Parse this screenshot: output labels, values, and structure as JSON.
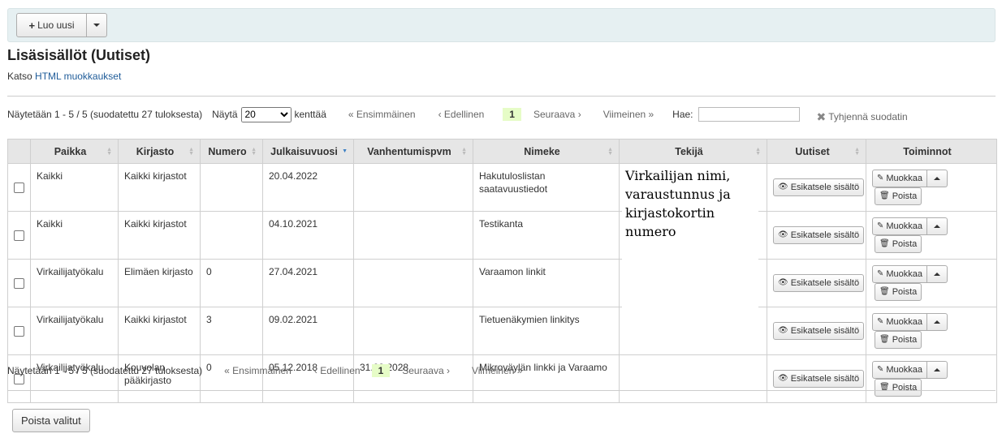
{
  "toolbar": {
    "new_label": "Luo uusi"
  },
  "page": {
    "title": "Lisäsisällöt (Uutiset)",
    "katso_prefix": "Katso",
    "katso_link": "HTML muokkaukset"
  },
  "top_pager": {
    "info": "Näytetään 1 - 5 / 5 (suodatettu 27 tuloksesta)",
    "show_label": "Näytä",
    "show_value": "20",
    "show_suffix": "kenttää",
    "first": "« Ensimmäinen",
    "prev": "‹ Edellinen",
    "current": "1",
    "next": "Seuraava ›",
    "last": "Viimeinen »",
    "search_label": "Hae:",
    "search_value": "",
    "clear": "Tyhjennä suodatin"
  },
  "columns": [
    "Paikka",
    "Kirjasto",
    "Numero",
    "Julkaisuvuosi",
    "Vanhentumispvm",
    "Nimeke",
    "Tekijä",
    "Uutiset",
    "Toiminnot"
  ],
  "rows": [
    {
      "paikka": "Kaikki",
      "kirjasto": "Kaikki kirjastot",
      "numero": "",
      "julkaisu": "20.04.2022",
      "vanhentuminen": "",
      "nimeke": "Hakutuloslistan saatavuustiedot"
    },
    {
      "paikka": "Kaikki",
      "kirjasto": "Kaikki kirjastot",
      "numero": "",
      "julkaisu": "04.10.2021",
      "vanhentuminen": "",
      "nimeke": "Testikanta"
    },
    {
      "paikka": "Virkailijatyökalu",
      "kirjasto": "Elimäen kirjasto",
      "numero": "0",
      "julkaisu": "27.04.2021",
      "vanhentuminen": "",
      "nimeke": "Varaamon linkit"
    },
    {
      "paikka": "Virkailijatyökalu",
      "kirjasto": "Kaikki kirjastot",
      "numero": "3",
      "julkaisu": "09.02.2021",
      "vanhentuminen": "",
      "nimeke": "Tietuenäkymien linkitys"
    },
    {
      "paikka": "Virkailijatyökalu",
      "kirjasto": "Kouvolan pääkirjasto",
      "numero": "0",
      "julkaisu": "05.12.2018",
      "vanhentuminen": "31.03.2028",
      "nimeke": "Mikroväylän linkki ja Varaamo"
    }
  ],
  "row_actions": {
    "preview": "Esikatsele sisältö",
    "edit": "Muokkaa",
    "delete": "Poista"
  },
  "overlay_text": "Virkailijan nimi, varaustunnus ja kirjastokortin numero",
  "bottom_pager": {
    "info": "Näytetään 1 - 5 / 5 (suodatettu 27 tuloksesta)",
    "first": "« Ensimmäinen",
    "prev": "‹ Edellinen",
    "current": "1",
    "next": "Seuraava ›",
    "last": "Viimeinen »"
  },
  "footer": {
    "delete_selected": "Poista valitut"
  }
}
